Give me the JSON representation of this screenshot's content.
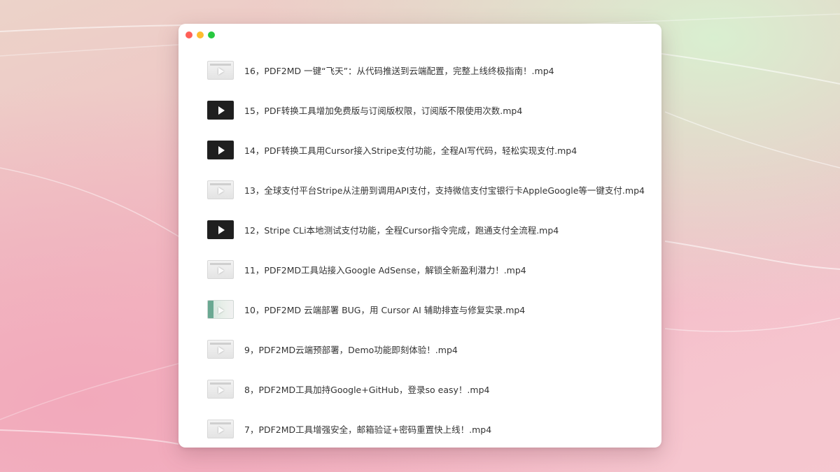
{
  "window": {
    "controls": [
      {
        "name": "close",
        "color": "#ff5f57"
      },
      {
        "name": "minimize",
        "color": "#febc2e"
      },
      {
        "name": "zoom",
        "color": "#28c840"
      }
    ]
  },
  "files": [
    {
      "name": "16，PDF2MD 一键“飞天”：从代码推送到云端配置，完整上线终极指南！.mp4",
      "thumbnail": "light"
    },
    {
      "name": "15，PDF转换工具增加免费版与订阅版权限，订阅版不限使用次数.mp4",
      "thumbnail": "dark"
    },
    {
      "name": "14，PDF转换工具用Cursor接入Stripe支付功能，全程AI写代码，轻松实现支付.mp4",
      "thumbnail": "dark"
    },
    {
      "name": "13，全球支付平台Stripe从注册到调用API支付，支持微信支付宝银行卡AppleGoogle等一键支付.mp4",
      "thumbnail": "light"
    },
    {
      "name": "12，Stripe CLi本地测试支付功能，全程Cursor指令完成，跑通支付全流程.mp4",
      "thumbnail": "dark"
    },
    {
      "name": "11，PDF2MD工具站接入Google AdSense，解锁全新盈利潜力！.mp4",
      "thumbnail": "light"
    },
    {
      "name": "10，PDF2MD 云端部署 BUG，用 Cursor AI 辅助排查与修复实录.mp4",
      "thumbnail": "teal"
    },
    {
      "name": "9，PDF2MD云端预部署，Demo功能即刻体验！.mp4",
      "thumbnail": "light"
    },
    {
      "name": "8，PDF2MD工具加持Google+GitHub，登录so easy！.mp4",
      "thumbnail": "light"
    },
    {
      "name": "7，PDF2MD工具增强安全，邮箱验证+密码重置快上线！.mp4",
      "thumbnail": "light"
    }
  ]
}
